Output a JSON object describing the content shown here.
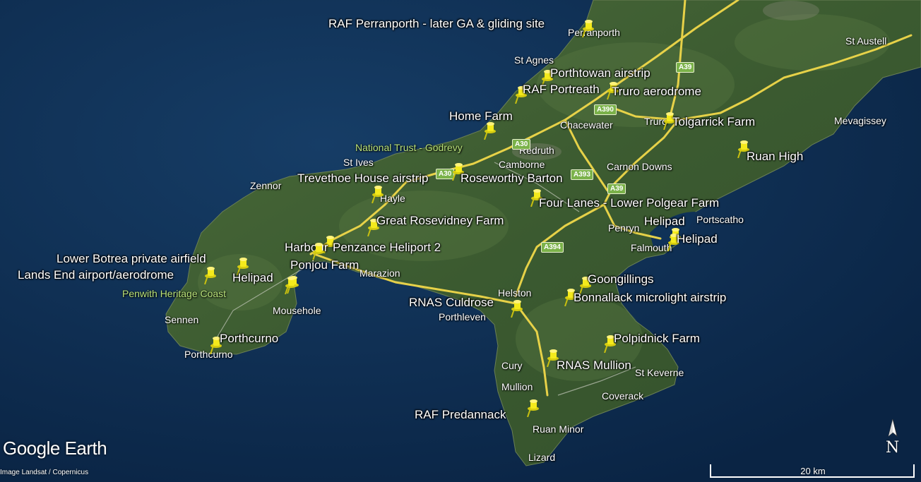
{
  "placemarks": [
    {
      "name": "RAF Perranporth - later GA & gliding site"
    },
    {
      "name": "Porthtowan airstrip"
    },
    {
      "name": "RAF Portreath"
    },
    {
      "name": "Truro aerodrome"
    },
    {
      "name": "Home Farm"
    },
    {
      "name": "Tolgarrick Farm"
    },
    {
      "name": "Ruan High"
    },
    {
      "name": "Trevethoe House airstrip"
    },
    {
      "name": "Roseworthy Barton"
    },
    {
      "name": "Four Lanes - Lower Polgear Farm"
    },
    {
      "name": "Great Rosevidney Farm"
    },
    {
      "name": "Helipad"
    },
    {
      "name": "Helipad"
    },
    {
      "name": "Harbour"
    },
    {
      "name": "Penzance Heliport 2"
    },
    {
      "name": "Lower Botrea private airfield"
    },
    {
      "name": "Ponjou Farm"
    },
    {
      "name": "Lands End airport/aerodrome"
    },
    {
      "name": "Helipad"
    },
    {
      "name": "Goongillings"
    },
    {
      "name": "Bonnallack microlight airstrip"
    },
    {
      "name": "RNAS Culdrose"
    },
    {
      "name": "Porthcurno"
    },
    {
      "name": "Polpidnick Farm"
    },
    {
      "name": "RNAS Mullion"
    },
    {
      "name": "RAF Predannack"
    }
  ],
  "towns": [
    "Perranporth",
    "St Agnes",
    "St Austell",
    "Chacewater",
    "Truro",
    "Mevagissey",
    "Redruth",
    "St Ives",
    "Camborne",
    "Carnon Downs",
    "Zennor",
    "Hayle",
    "Portscatho",
    "Penryn",
    "Falmouth",
    "Marazion",
    "Helston",
    "Porthleven",
    "Mousehole",
    "Sennen",
    "Porthcurno",
    "Cury",
    "St Keverne",
    "Mullion",
    "Coverack",
    "Ruan Minor",
    "Lizard"
  ],
  "areas": [
    "National Trust - Godrevy",
    "Penwith Heritage Coast"
  ],
  "roads": [
    "A39",
    "A390",
    "A30",
    "A393",
    "A39",
    "A394",
    "A30"
  ],
  "branding": {
    "logo": "Google Earth",
    "credit": "Image Landsat / Copernicus"
  },
  "scale_bar": {
    "label": "20 km"
  },
  "compass": {
    "label": "N"
  },
  "colors": {
    "road": "#f0d84a",
    "pin": "#f4ea1c",
    "sea": "#0b2a4a",
    "land": "#3f5e33"
  }
}
